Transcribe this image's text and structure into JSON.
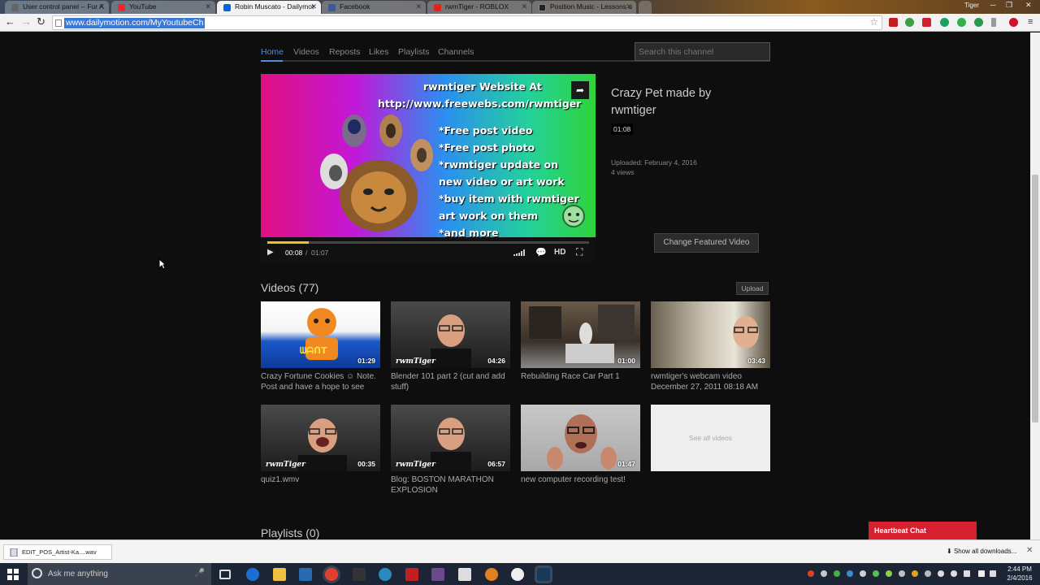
{
  "browser": {
    "tabs": [
      {
        "label": "User control panel -- Fur A",
        "color": "#555"
      },
      {
        "label": "YouTube",
        "color": "#e52d27"
      },
      {
        "label": "Robin Muscato - Dailymot",
        "color": "#0066dc"
      },
      {
        "label": "Facebook",
        "color": "#3b5998"
      },
      {
        "label": "rwmTiger - ROBLOX",
        "color": "#e2231a"
      },
      {
        "label": "Position Music - Lessons o",
        "color": "#222"
      }
    ],
    "user_label": "Tiger",
    "url": "www.dailymotion.com/MyYoutubeCh"
  },
  "channel_nav": {
    "tabs": [
      "Home",
      "Videos",
      "Reposts",
      "Likes",
      "Playlists",
      "Channels"
    ],
    "active_tab": "Home",
    "search_placeholder": "Search this channel"
  },
  "featured": {
    "promo_lines": [
      "rwmtiger Website At",
      "http://www.freewebs.com/rwmtiger",
      "*Free post video",
      "*Free post photo",
      "*rwmtiger update on",
      "new video or art work",
      "*buy item with rwmtiger",
      "art work on them",
      "*and more"
    ],
    "current_time": "00:08",
    "separator": "/",
    "total_time": "01:07",
    "progress": 0.13,
    "hd_label": "HD",
    "title": "Crazy Pet made by rwmtiger",
    "duration": "01:08",
    "uploaded": "Uploaded: February 4, 2016",
    "views": "4 views",
    "change_button": "Change Featured Video"
  },
  "videos_section": {
    "heading": "Videos (77)",
    "upload_button": "Upload",
    "see_all": "See all videos",
    "items": [
      {
        "title": "Crazy Fortune Cookies ☺ Note. Post and have a hope to see",
        "duration": "01:29"
      },
      {
        "title": "Blender 101 part 2 (cut and add stuff)",
        "duration": "04:26"
      },
      {
        "title": "Rebuilding Race Car Part 1",
        "duration": "01:00"
      },
      {
        "title": "rwmtiger's webcam video December 27, 2011 08:18 AM",
        "duration": "03:43"
      },
      {
        "title": "quiz1.wmv",
        "duration": "00:35"
      },
      {
        "title": "Blog: BOSTON MARATHON EXPLOSION",
        "duration": "06:57"
      },
      {
        "title": "new computer recording test!",
        "duration": "01:47"
      }
    ]
  },
  "playlists_heading": "Playlists (0)",
  "heartbeat_chat": "Heartbeat Chat",
  "download_bar": {
    "file": "EDIT_POS_Artist-Ka....wav",
    "show_all": "Show all downloads..."
  },
  "taskbar": {
    "search_placeholder": "Ask me anything",
    "time": "2:44 PM",
    "date": "2/4/2016"
  }
}
